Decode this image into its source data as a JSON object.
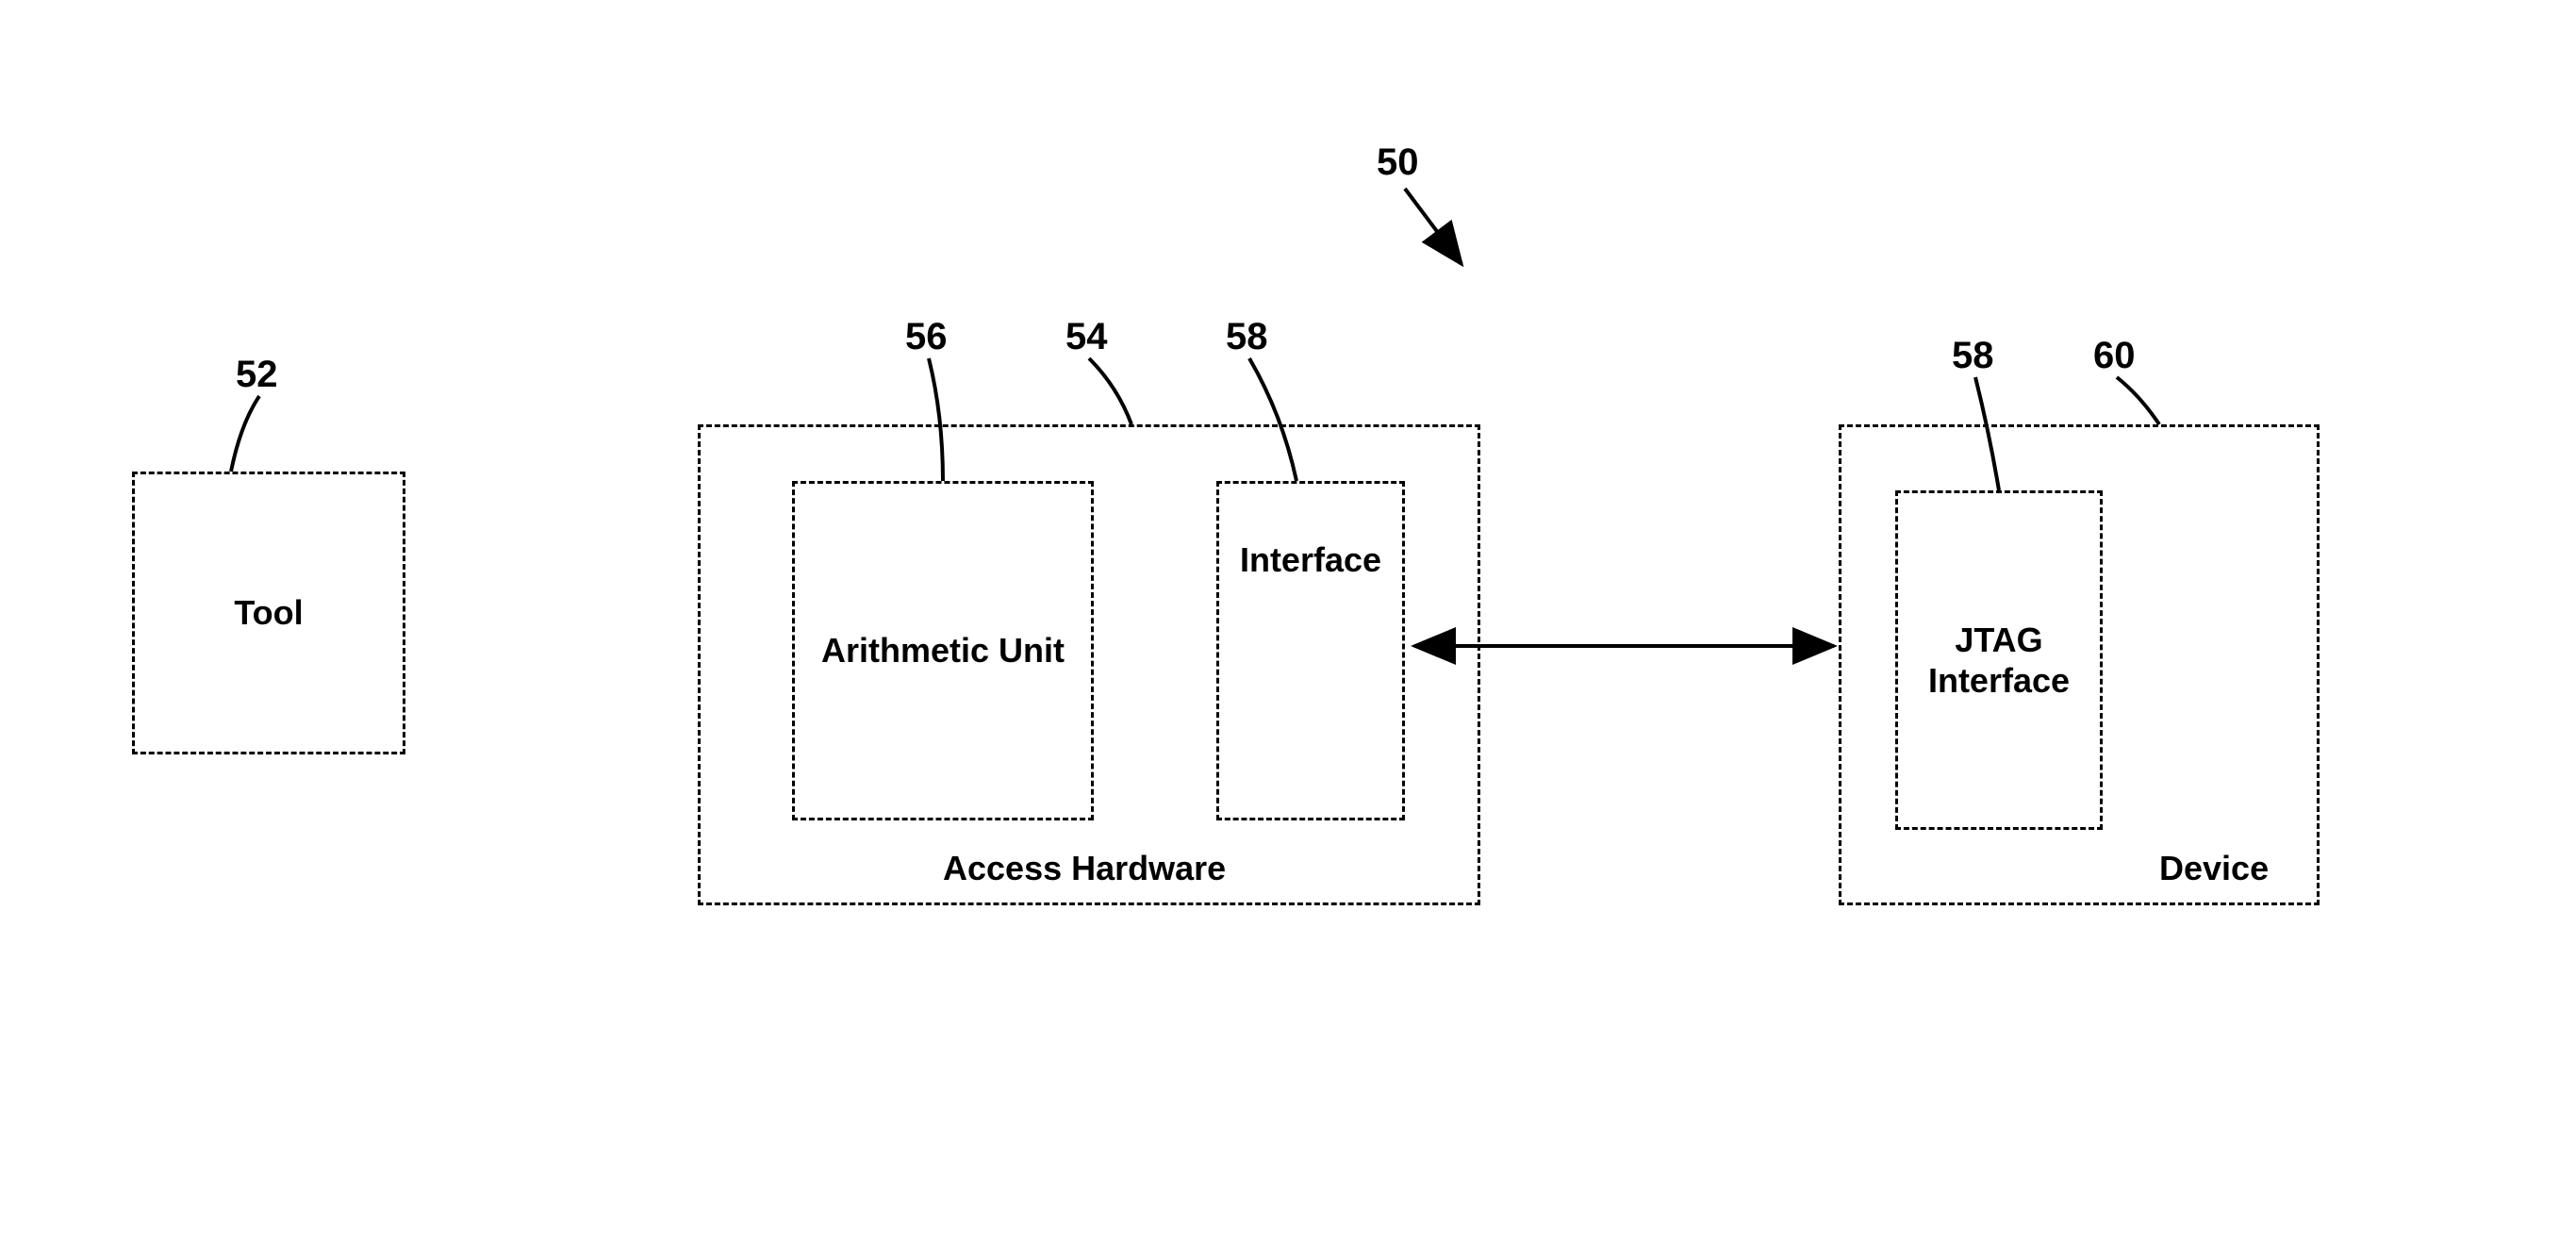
{
  "refs": {
    "fig": "50",
    "tool": "52",
    "access_hw": "54",
    "arith": "56",
    "interface1": "58",
    "jtag_ref": "58",
    "device": "60"
  },
  "labels": {
    "tool": "Tool",
    "arith": "Arithmetic\nUnit",
    "interface": "Interface",
    "access_hw": "Access Hardware",
    "jtag": "JTAG\nInterface",
    "device": "Device"
  }
}
